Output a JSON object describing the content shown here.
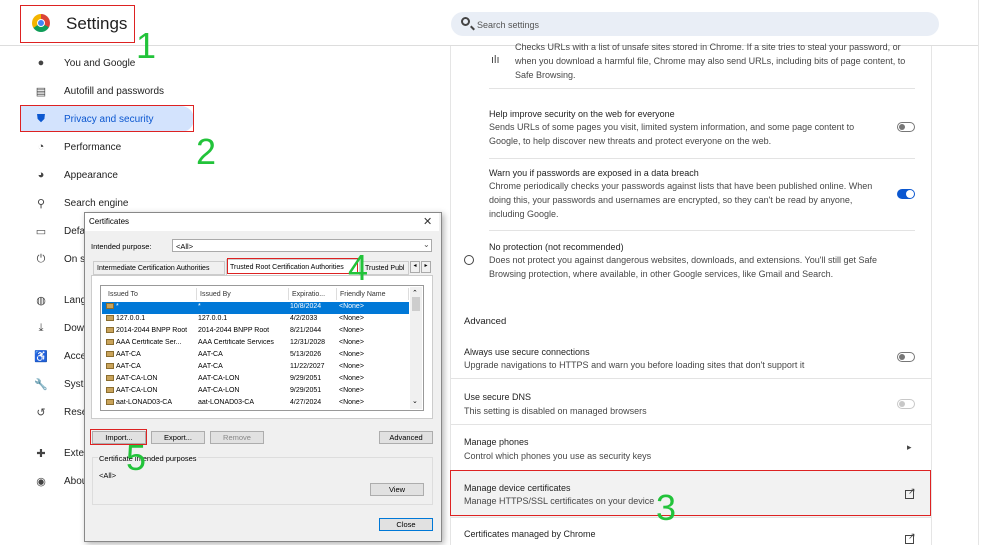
{
  "header": {
    "app_title": "Settings",
    "search_placeholder": "Search settings"
  },
  "sidebar": {
    "items": [
      {
        "label": "You and Google",
        "icon": "person-icon"
      },
      {
        "label": "Autofill and passwords",
        "icon": "clipboard-icon"
      },
      {
        "label": "Privacy and security",
        "icon": "shield-icon",
        "active": true
      },
      {
        "label": "Performance",
        "icon": "speedometer-icon"
      },
      {
        "label": "Appearance",
        "icon": "palette-icon"
      },
      {
        "label": "Search engine",
        "icon": "search-icon"
      },
      {
        "label": "Defa",
        "icon": "browser-icon"
      },
      {
        "label": "On s",
        "icon": "power-icon"
      },
      {
        "label": "Lang",
        "icon": "globe-icon"
      },
      {
        "label": "Dow",
        "icon": "download-icon"
      },
      {
        "label": "Acce",
        "icon": "accessibility-icon"
      },
      {
        "label": "Syste",
        "icon": "wrench-icon"
      },
      {
        "label": "Rese",
        "icon": "history-icon"
      },
      {
        "label": "Exte",
        "icon": "puzzle-icon"
      },
      {
        "label": "Abou",
        "icon": "chrome-icon"
      }
    ]
  },
  "main": {
    "top_desc": "Checks URLs with a list of unsafe sites stored in Chrome. If a site tries to steal your password, or when you download a harmful file, Chrome may also send URLs, including bits of page content, to Safe Browsing.",
    "help_improve_title": "Help improve security on the web for everyone",
    "help_improve_desc": "Sends URLs of some pages you visit, limited system information, and some page content to Google, to help discover new threats and protect everyone on the web.",
    "warn_title": "Warn you if passwords are exposed in a data breach",
    "warn_desc": "Chrome periodically checks your passwords against lists that have been published online. When doing this, your passwords and usernames are encrypted, so they can't be read by anyone, including Google.",
    "no_protection_title": "No protection (not recommended)",
    "no_protection_desc": "Does not protect you against dangerous websites, downloads, and extensions. You'll still get Safe Browsing protection, where available, in other Google services, like Gmail and Search.",
    "advanced_heading": "Advanced",
    "secure_conn_title": "Always use secure connections",
    "secure_conn_desc": "Upgrade navigations to HTTPS and warn you before loading sites that don't support it",
    "secure_dns_title": "Use secure DNS",
    "secure_dns_desc": "This setting is disabled on managed browsers",
    "phones_title": "Manage phones",
    "phones_desc": "Control which phones you use as security keys",
    "device_certs_title": "Manage device certificates",
    "device_certs_desc": "Manage HTTPS/SSL certificates on your device",
    "chrome_certs_title": "Certificates managed by Chrome"
  },
  "dialog": {
    "title": "Certificates",
    "close_glyph": "✕",
    "intended_purpose_label": "Intended purpose:",
    "intended_purpose_value": "<All>",
    "tabs": [
      "Intermediate Certification Authorities",
      "Trusted Root Certification Authorities",
      "Trusted Publ"
    ],
    "columns": [
      "Issued To",
      "Issued By",
      "Expiratio...",
      "Friendly Name"
    ],
    "rows": [
      [
        "*",
        "*",
        "10/8/2024",
        "<None>"
      ],
      [
        "127.0.0.1",
        "127.0.0.1",
        "4/2/2033",
        "<None>"
      ],
      [
        "2014-2044 BNPP Root",
        "2014-2044 BNPP Root",
        "8/21/2044",
        "<None>"
      ],
      [
        "AAA Certificate Ser...",
        "AAA Certificate Services",
        "12/31/2028",
        "<None>"
      ],
      [
        "AAT-CA",
        "AAT-CA",
        "5/13/2026",
        "<None>"
      ],
      [
        "AAT-CA",
        "AAT-CA",
        "11/22/2027",
        "<None>"
      ],
      [
        "AAT-CA-LON",
        "AAT-CA-LON",
        "9/29/2051",
        "<None>"
      ],
      [
        "AAT-CA-LON",
        "AAT-CA-LON",
        "9/29/2051",
        "<None>"
      ],
      [
        "aat-LONAD03-CA",
        "aat-LONAD03-CA",
        "4/27/2024",
        "<None>"
      ]
    ],
    "import_label": "Import...",
    "export_label": "Export...",
    "remove_label": "Remove",
    "advanced_label": "Advanced",
    "purposes_label": "Certificate intended purposes",
    "purposes_value": "<All>",
    "view_label": "View",
    "close_label": "Close"
  },
  "annotations": [
    "1",
    "2",
    "3",
    "4",
    "5"
  ],
  "colors": {
    "annotation_red": "#dd2222",
    "annotation_green": "#22c33a",
    "accent_blue": "#0b57d0"
  }
}
